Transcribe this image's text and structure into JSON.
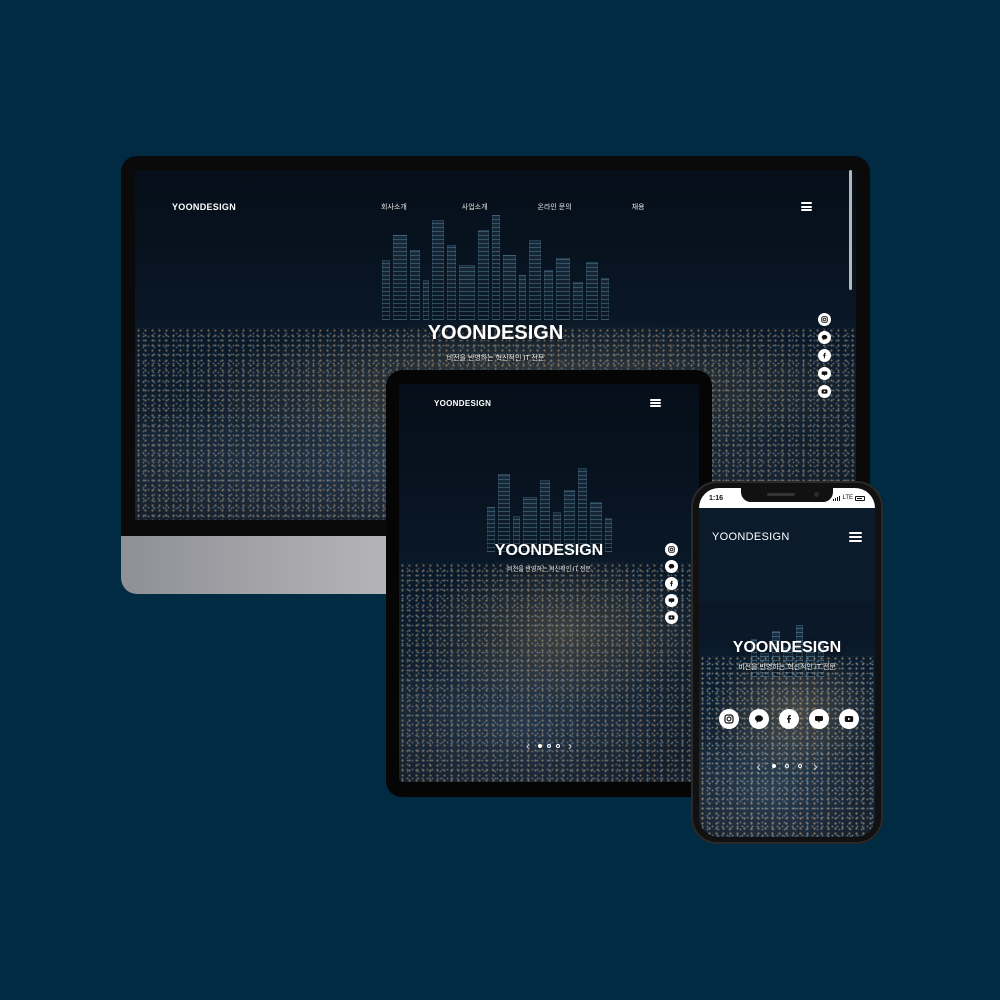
{
  "site": {
    "logo": "YOONDESIGN",
    "hero_title": "YOONDESIGN",
    "hero_subtitle": "비전을 반영하는 혁신적인 IT 전문",
    "nav": [
      "회사소개",
      "사업소개",
      "온라인 문의",
      "채용"
    ]
  },
  "social_icons": [
    "instagram-icon",
    "kakaotalk-icon",
    "facebook-icon",
    "blog-icon",
    "youtube-icon"
  ],
  "phone_status": {
    "time": "1:16",
    "network": "LTE"
  },
  "slider": {
    "dots": 3,
    "active_index": 0
  },
  "colors": {
    "background": "#012a43",
    "text": "#ffffff"
  }
}
